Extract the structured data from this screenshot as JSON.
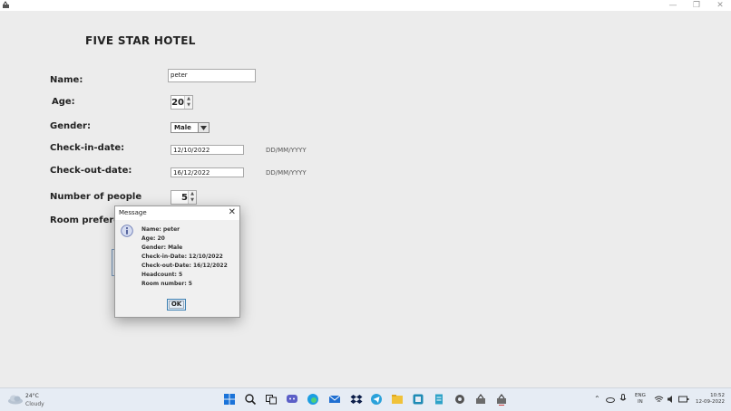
{
  "window": {
    "title": ""
  },
  "form": {
    "hotel_title": "FIVE STAR HOTEL",
    "name_label": "Name:",
    "name_value": "peter",
    "age_label": "Age:",
    "age_value": "20",
    "gender_label": "Gender:",
    "gender_value": "Male",
    "checkin_label": "Check-in-date:",
    "checkin_value": "12/10/2022",
    "checkin_hint": "DD/MM/YYYY",
    "checkout_label": "Check-out-date:",
    "checkout_value": "16/12/2022",
    "checkout_hint": "DD/MM/YYYY",
    "people_label": "Number of people",
    "people_value": "5",
    "room_pref_label": "Room preferen"
  },
  "dialog": {
    "title": "Message",
    "close_glyph": "✕",
    "lines": [
      "Name: peter",
      "Age: 20",
      "Gender: Male",
      "Check-in-Date: 12/10/2022",
      "Check-out-Date: 16/12/2022",
      "Headcount: 5",
      "Room number: 5"
    ],
    "ok_label": "OK"
  },
  "taskbar": {
    "weather_temp": "24°C",
    "weather_desc": "Cloudy",
    "lang_line1": "ENG",
    "lang_line2": "IN",
    "time": "10:52",
    "date": "12-09-2022",
    "icons": [
      "windows-start-icon",
      "search-icon",
      "task-view-icon",
      "chat-icon",
      "edge-icon",
      "mail-icon",
      "dropbox-icon",
      "telegram-icon",
      "file-explorer-icon",
      "store-icon",
      "notepad-icon",
      "settings-icon",
      "java-app-icon",
      "java-app-icon-2"
    ]
  }
}
